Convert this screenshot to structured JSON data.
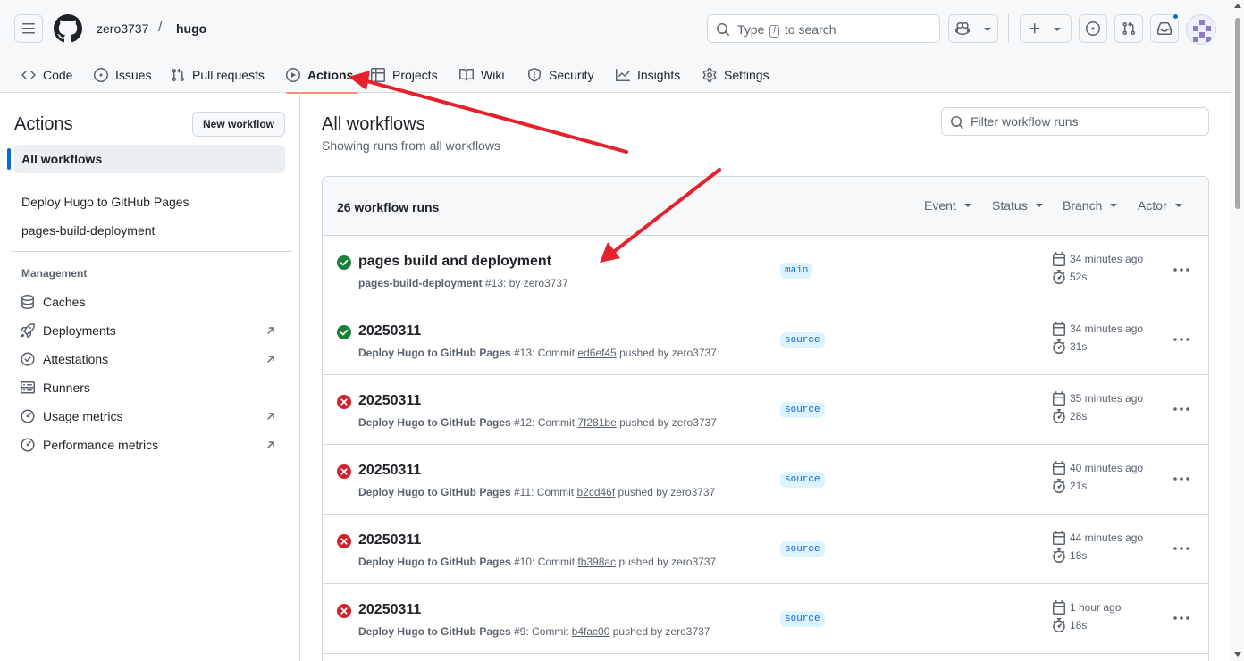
{
  "header": {
    "owner": "zero3737",
    "separator": "/",
    "repo": "hugo",
    "search_prefix": "Type",
    "search_key": "/",
    "search_suffix": "to search"
  },
  "tabs": [
    {
      "label": "Code",
      "icon": "code-icon"
    },
    {
      "label": "Issues",
      "icon": "issue-opened-icon"
    },
    {
      "label": "Pull requests",
      "icon": "git-pull-request-icon"
    },
    {
      "label": "Actions",
      "icon": "play-icon",
      "active": true
    },
    {
      "label": "Projects",
      "icon": "table-icon"
    },
    {
      "label": "Wiki",
      "icon": "book-icon"
    },
    {
      "label": "Security",
      "icon": "shield-icon"
    },
    {
      "label": "Insights",
      "icon": "graph-icon"
    },
    {
      "label": "Settings",
      "icon": "gear-icon"
    }
  ],
  "sidebar": {
    "title": "Actions",
    "new_workflow_label": "New workflow",
    "all_workflows_label": "All workflows",
    "workflows": [
      "Deploy Hugo to GitHub Pages",
      "pages-build-deployment"
    ],
    "management_heading": "Management",
    "management": [
      {
        "label": "Caches",
        "icon": "database-icon",
        "external": false
      },
      {
        "label": "Deployments",
        "icon": "rocket-icon",
        "external": true
      },
      {
        "label": "Attestations",
        "icon": "verified-icon",
        "external": true
      },
      {
        "label": "Runners",
        "icon": "server-icon",
        "external": false
      },
      {
        "label": "Usage metrics",
        "icon": "meter-icon",
        "external": true
      },
      {
        "label": "Performance metrics",
        "icon": "meter-icon",
        "external": true
      }
    ]
  },
  "main": {
    "title": "All workflows",
    "subtitle": "Showing runs from all workflows",
    "filter_placeholder": "Filter workflow runs",
    "run_count": "26 workflow runs",
    "filters": [
      "Event",
      "Status",
      "Branch",
      "Actor"
    ],
    "runs": [
      {
        "status": "success",
        "title": "pages build and deployment",
        "workflow": "pages-build-deployment",
        "meta_tail": " #13: by zero3737",
        "commit": "",
        "pushed_by": "",
        "branch": "main",
        "time": "34 minutes ago",
        "duration": "52s"
      },
      {
        "status": "success",
        "title": "20250311",
        "workflow": "Deploy Hugo to GitHub Pages",
        "meta_tail": " #13: Commit ",
        "commit": "ed6ef45",
        "pushed_by": " pushed by zero3737",
        "branch": "source",
        "time": "34 minutes ago",
        "duration": "31s"
      },
      {
        "status": "failure",
        "title": "20250311",
        "workflow": "Deploy Hugo to GitHub Pages",
        "meta_tail": " #12: Commit ",
        "commit": "7f281be",
        "pushed_by": " pushed by zero3737",
        "branch": "source",
        "time": "35 minutes ago",
        "duration": "28s"
      },
      {
        "status": "failure",
        "title": "20250311",
        "workflow": "Deploy Hugo to GitHub Pages",
        "meta_tail": " #11: Commit ",
        "commit": "b2cd46f",
        "pushed_by": " pushed by zero3737",
        "branch": "source",
        "time": "40 minutes ago",
        "duration": "21s"
      },
      {
        "status": "failure",
        "title": "20250311",
        "workflow": "Deploy Hugo to GitHub Pages",
        "meta_tail": " #10: Commit ",
        "commit": "fb398ac",
        "pushed_by": " pushed by zero3737",
        "branch": "source",
        "time": "44 minutes ago",
        "duration": "18s"
      },
      {
        "status": "failure",
        "title": "20250311",
        "workflow": "Deploy Hugo to GitHub Pages",
        "meta_tail": " #9: Commit ",
        "commit": "b4fac00",
        "pushed_by": " pushed by zero3737",
        "branch": "source",
        "time": "1 hour ago",
        "duration": "18s"
      }
    ]
  },
  "colors": {
    "success": "#1a7f37",
    "failure": "#cf222e",
    "accent": "#0969da",
    "tab_underline": "#fd8c73",
    "annotation_arrow": "#e5222b"
  }
}
